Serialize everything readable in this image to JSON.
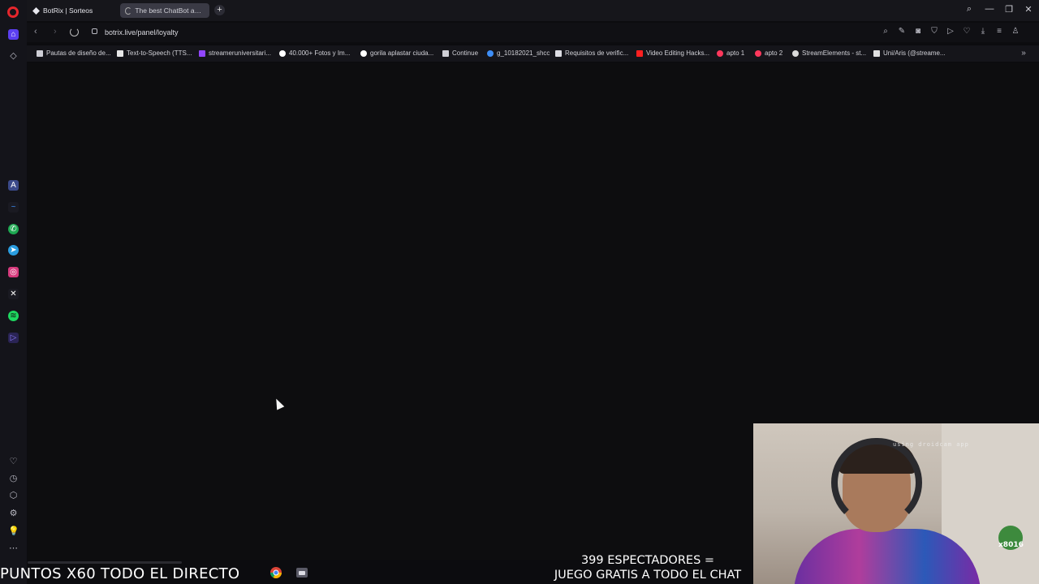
{
  "browser": {
    "tabs": [
      {
        "label": "BotRix | Sorteos"
      },
      {
        "label": "The best ChatBot and Wi"
      }
    ],
    "new_tab_label": "+",
    "url": "botrix.live/panel/loyalty",
    "window_controls": {
      "minimize": "—",
      "restore": "❐",
      "close": "✕"
    }
  },
  "bookmarks": [
    {
      "label": "Pautas de diseño de...",
      "icon": "doc-icon"
    },
    {
      "label": "Text-to-Speech (TTS...",
      "icon": "tts-icon"
    },
    {
      "label": "streameruniversitari...",
      "icon": "twitch-icon"
    },
    {
      "label": "40.000+ Fotos y Im...",
      "icon": "pexels-icon"
    },
    {
      "label": "gorila aplastar ciuda...",
      "icon": "google-icon"
    },
    {
      "label": "Continue",
      "icon": "doc-icon"
    },
    {
      "label": "g_10182021_shcc",
      "icon": "plane-icon"
    },
    {
      "label": "Requisitos de verific...",
      "icon": "x-icon"
    },
    {
      "label": "Video Editing Hacks...",
      "icon": "youtube-icon"
    },
    {
      "label": "apto 1",
      "icon": "airbnb-icon"
    },
    {
      "label": "apto 2",
      "icon": "airbnb-icon"
    },
    {
      "label": "StreamElements - st...",
      "icon": "streamelements-icon"
    },
    {
      "label": "Uni/Aris (@streame...",
      "icon": "tiktok-icon"
    }
  ],
  "webcam": {
    "watermark": "using droidcam app",
    "badge": "x8016"
  },
  "stream_overlay": {
    "ticker": "PUNTOS X60 TODO EL DIRECTO",
    "viewers_line1": "399 ESPECTADORES =",
    "viewers_line2": "JUEGO GRATIS A TODO EL CHAT"
  },
  "colors": {
    "opera_red": "#e5262c",
    "page_bg": "#0d0d0f"
  }
}
